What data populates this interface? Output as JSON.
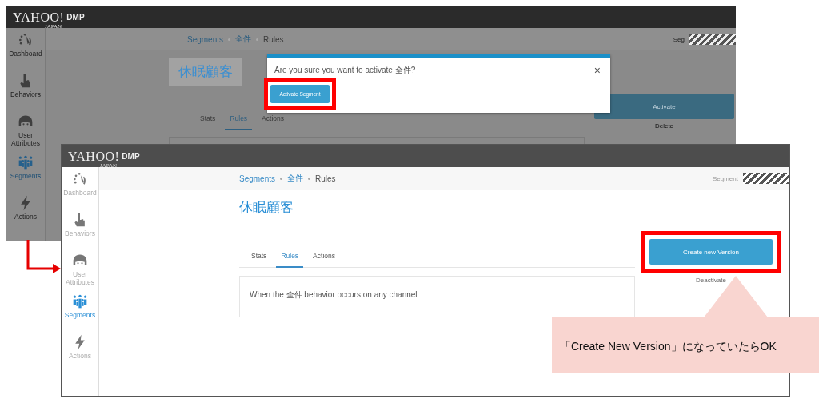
{
  "screenshots": [
    {
      "kind": "dialog",
      "logo": {
        "name": "YAHOO!",
        "sub": "JAPAN",
        "product": "DMP"
      },
      "sidebar": [
        {
          "label": "Dashboard",
          "kind": "dashboard",
          "selected": false
        },
        {
          "label": "Behaviors",
          "kind": "behaviors",
          "selected": false
        },
        {
          "label": "User Attributes",
          "kind": "user",
          "selected": false
        },
        {
          "label": "Segments",
          "kind": "segments",
          "selected": true
        },
        {
          "label": "Actions",
          "kind": "actions",
          "selected": false
        }
      ],
      "breadcrumb": [
        "Segments",
        "全件",
        "Rules"
      ],
      "user_label": "Seg",
      "title": "休眠顧客",
      "tabs": [
        {
          "label": "Stats",
          "selected": false
        },
        {
          "label": "Rules",
          "selected": true
        },
        {
          "label": "Actions",
          "selected": false
        }
      ],
      "dialog": {
        "message": "Are you sure you want to activate 全件?",
        "confirm": "Activate Segment",
        "confirm_highlighted": true,
        "close": "×"
      },
      "primary_button": "Activate",
      "primary_highlighted": false,
      "secondary_link": "Delete"
    },
    {
      "kind": "page",
      "logo": {
        "name": "YAHOO!",
        "sub": "JAPAN",
        "product": "DMP"
      },
      "sidebar": [
        {
          "label": "Dashboard",
          "kind": "dashboard",
          "selected": false
        },
        {
          "label": "Behaviors",
          "kind": "behaviors",
          "selected": false
        },
        {
          "label": "User Attributes",
          "kind": "user",
          "selected": false
        },
        {
          "label": "Segments",
          "kind": "segments",
          "selected": true
        },
        {
          "label": "Actions",
          "kind": "actions",
          "selected": false
        }
      ],
      "breadcrumb": [
        "Segments",
        "全件",
        "Rules"
      ],
      "user_label": "Segment",
      "title": "休眠顧客",
      "tabs": [
        {
          "label": "Stats",
          "selected": false
        },
        {
          "label": "Rules",
          "selected": true
        },
        {
          "label": "Actions",
          "selected": false
        }
      ],
      "rule_text": "When the 全件 behavior occurs on any channel",
      "primary_button": "Create new Version",
      "primary_highlighted": true,
      "secondary_link": "Deactivate"
    }
  ],
  "callout": "「Create New Version」になっていたらOK"
}
